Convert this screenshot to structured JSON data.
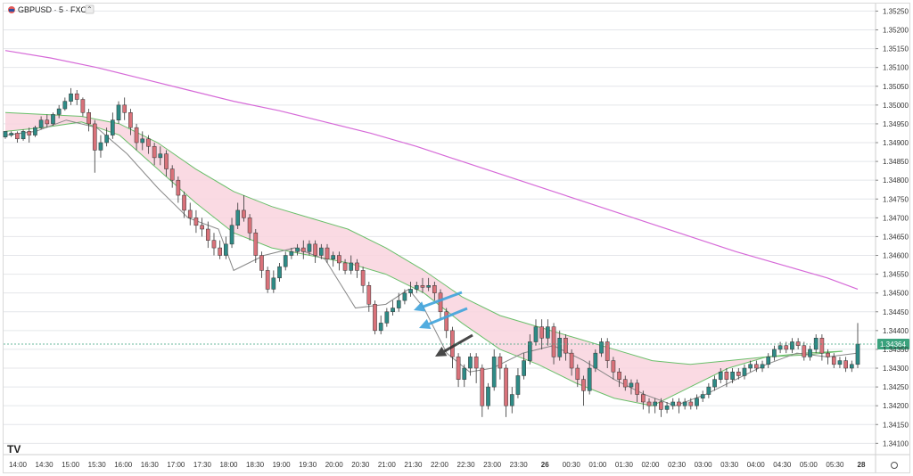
{
  "header": {
    "symbol_title": "GBPUSD · 5 · FXCM",
    "logo_mark": "TV"
  },
  "chart_data": {
    "type": "candlestick",
    "title": "GBPUSD · 5 · FXCM",
    "y_ticks": [
      "1.35250",
      "1.35200",
      "1.35150",
      "1.35100",
      "1.35050",
      "1.35000",
      "1.34950",
      "1.34900",
      "1.34850",
      "1.34800",
      "1.34750",
      "1.34700",
      "1.34650",
      "1.34600",
      "1.34550",
      "1.34500",
      "1.34450",
      "1.34400",
      "1.34350",
      "1.34300",
      "1.34250",
      "1.34200",
      "1.34150",
      "1.34100"
    ],
    "ylim": [
      1.3407,
      1.3527
    ],
    "x_ticks": [
      "14:00",
      "14:30",
      "15:00",
      "15:30",
      "16:00",
      "16:30",
      "17:00",
      "17:30",
      "18:00",
      "18:30",
      "19:00",
      "19:30",
      "20:00",
      "20:30",
      "21:00",
      "21:30",
      "22:00",
      "22:30",
      "23:00",
      "23:30",
      "26",
      "00:30",
      "01:00",
      "01:30",
      "02:00",
      "02:30",
      "03:00",
      "03:30",
      "04:00",
      "04:30",
      "05:00",
      "05:30",
      "28"
    ],
    "current_price": "1.34364",
    "colors": {
      "up": "#2e8b86",
      "down": "#d9727a",
      "long_ma": "#d66ad8",
      "band_fill": "#f9d4de",
      "band_edge": "#6abf6a",
      "fast_ma": "#888888",
      "arrow_blue": "#3ea3dc",
      "arrow_dark": "#333333",
      "price_tag": "#3aa27d"
    },
    "long_ma": [
      [
        0,
        1.35145
      ],
      [
        12,
        1.35125
      ],
      [
        24,
        1.351
      ],
      [
        36,
        1.3507
      ],
      [
        48,
        1.3504
      ],
      [
        60,
        1.3501
      ],
      [
        72,
        1.34985
      ],
      [
        84,
        1.34955
      ],
      [
        96,
        1.34925
      ],
      [
        108,
        1.3489
      ],
      [
        120,
        1.3485
      ],
      [
        132,
        1.3481
      ],
      [
        144,
        1.3477
      ],
      [
        156,
        1.3473
      ],
      [
        168,
        1.3469
      ],
      [
        180,
        1.3465
      ],
      [
        192,
        1.3461
      ],
      [
        204,
        1.34575
      ],
      [
        216,
        1.3454
      ],
      [
        224,
        1.3451
      ]
    ],
    "band_upper": [
      [
        0,
        1.3498
      ],
      [
        10,
        1.34975
      ],
      [
        20,
        1.3497
      ],
      [
        30,
        1.3495
      ],
      [
        40,
        1.349
      ],
      [
        50,
        1.3483
      ],
      [
        60,
        1.3477
      ],
      [
        70,
        1.3473
      ],
      [
        80,
        1.347
      ],
      [
        90,
        1.3467
      ],
      [
        100,
        1.3462
      ],
      [
        110,
        1.3456
      ],
      [
        120,
        1.3449
      ],
      [
        130,
        1.3444
      ],
      [
        140,
        1.3441
      ],
      [
        150,
        1.3438
      ],
      [
        160,
        1.3435
      ],
      [
        170,
        1.3432
      ],
      [
        180,
        1.3431
      ],
      [
        190,
        1.3432
      ],
      [
        200,
        1.3433
      ],
      [
        210,
        1.3434
      ],
      [
        220,
        1.34345
      ]
    ],
    "band_lower": [
      [
        0,
        1.3493
      ],
      [
        10,
        1.3494
      ],
      [
        20,
        1.34955
      ],
      [
        30,
        1.3492
      ],
      [
        40,
        1.3483
      ],
      [
        50,
        1.3474
      ],
      [
        60,
        1.3466
      ],
      [
        70,
        1.3462
      ],
      [
        80,
        1.346
      ],
      [
        90,
        1.3458
      ],
      [
        100,
        1.3455
      ],
      [
        110,
        1.345
      ],
      [
        120,
        1.3442
      ],
      [
        130,
        1.3435
      ],
      [
        140,
        1.3431
      ],
      [
        150,
        1.3426
      ],
      [
        160,
        1.3422
      ],
      [
        170,
        1.342
      ],
      [
        180,
        1.3425
      ],
      [
        190,
        1.343
      ],
      [
        200,
        1.3433
      ],
      [
        210,
        1.34335
      ],
      [
        220,
        1.34345
      ]
    ],
    "fast_ma": [
      [
        0,
        1.3492
      ],
      [
        8,
        1.3493
      ],
      [
        16,
        1.3496
      ],
      [
        24,
        1.3494
      ],
      [
        32,
        1.3487
      ],
      [
        40,
        1.3478
      ],
      [
        48,
        1.347
      ],
      [
        56,
        1.3467
      ],
      [
        60,
        1.3456
      ],
      [
        68,
        1.346
      ],
      [
        76,
        1.3462
      ],
      [
        84,
        1.3459
      ],
      [
        92,
        1.3446
      ],
      [
        100,
        1.3447
      ],
      [
        106,
        1.3451
      ],
      [
        110,
        1.3446
      ],
      [
        116,
        1.3434
      ],
      [
        122,
        1.3429
      ],
      [
        128,
        1.343
      ],
      [
        136,
        1.3434
      ],
      [
        144,
        1.3436
      ],
      [
        152,
        1.3432
      ],
      [
        160,
        1.3427
      ],
      [
        168,
        1.3423
      ],
      [
        176,
        1.342
      ],
      [
        184,
        1.3423
      ],
      [
        192,
        1.3427
      ],
      [
        200,
        1.3431
      ],
      [
        208,
        1.3434
      ],
      [
        216,
        1.3433
      ],
      [
        224,
        1.3434
      ]
    ],
    "candles": [
      [
        0,
        1.34915,
        1.3493,
        1.3493,
        1.3491
      ],
      [
        1,
        1.3492,
        1.34925,
        1.3493,
        1.34915
      ],
      [
        2,
        1.34925,
        1.3491,
        1.3493,
        1.349
      ],
      [
        3,
        1.3491,
        1.3493,
        1.34935,
        1.34905
      ],
      [
        4,
        1.3493,
        1.3492,
        1.3494,
        1.349
      ],
      [
        5,
        1.3492,
        1.3494,
        1.34945,
        1.34915
      ],
      [
        6,
        1.3494,
        1.3496,
        1.3497,
        1.34935
      ],
      [
        7,
        1.3496,
        1.3495,
        1.34975,
        1.3494
      ],
      [
        8,
        1.3495,
        1.34975,
        1.3498,
        1.34945
      ],
      [
        9,
        1.34975,
        1.3499,
        1.35,
        1.34965
      ],
      [
        10,
        1.3499,
        1.3501,
        1.3502,
        1.34985
      ],
      [
        11,
        1.3501,
        1.3503,
        1.35045,
        1.35
      ],
      [
        12,
        1.3503,
        1.35015,
        1.3504,
        1.35
      ],
      [
        13,
        1.35015,
        1.3498,
        1.3502,
        1.3497
      ],
      [
        14,
        1.3498,
        1.3495,
        1.3499,
        1.3493
      ],
      [
        15,
        1.3495,
        1.3488,
        1.3496,
        1.3482
      ],
      [
        16,
        1.3488,
        1.349,
        1.3492,
        1.3486
      ],
      [
        17,
        1.349,
        1.3492,
        1.3494,
        1.3489
      ],
      [
        18,
        1.3492,
        1.3496,
        1.3498,
        1.3491
      ],
      [
        19,
        1.3496,
        1.35,
        1.3501,
        1.3495
      ],
      [
        20,
        1.35,
        1.3498,
        1.3502,
        1.3496
      ],
      [
        21,
        1.3498,
        1.3494,
        1.3499,
        1.3492
      ],
      [
        22,
        1.3494,
        1.349,
        1.3495,
        1.3488
      ],
      [
        23,
        1.349,
        1.3491,
        1.3493,
        1.3488
      ],
      [
        24,
        1.3491,
        1.3489,
        1.3492,
        1.3487
      ],
      [
        25,
        1.3489,
        1.3486,
        1.349,
        1.3484
      ],
      [
        26,
        1.3486,
        1.3487,
        1.3489,
        1.3484
      ],
      [
        27,
        1.3487,
        1.3483,
        1.3488,
        1.3481
      ],
      [
        28,
        1.3483,
        1.348,
        1.3484,
        1.3478
      ],
      [
        29,
        1.348,
        1.3476,
        1.3481,
        1.3474
      ],
      [
        30,
        1.3476,
        1.3472,
        1.3477,
        1.347
      ],
      [
        31,
        1.3472,
        1.347,
        1.3474,
        1.3468
      ],
      [
        32,
        1.347,
        1.3468,
        1.3472,
        1.3466
      ],
      [
        33,
        1.3468,
        1.3467,
        1.347,
        1.3465
      ],
      [
        34,
        1.3467,
        1.3464,
        1.3469,
        1.3462
      ],
      [
        35,
        1.3464,
        1.3462,
        1.3466,
        1.346
      ],
      [
        36,
        1.3462,
        1.346,
        1.3464,
        1.3459
      ],
      [
        37,
        1.346,
        1.3463,
        1.3465,
        1.3459
      ],
      [
        38,
        1.3463,
        1.3468,
        1.347,
        1.3462
      ],
      [
        39,
        1.3468,
        1.3472,
        1.3474,
        1.3467
      ],
      [
        40,
        1.3472,
        1.347,
        1.3476,
        1.3469
      ],
      [
        41,
        1.347,
        1.3466,
        1.3471,
        1.3464
      ],
      [
        42,
        1.3466,
        1.346,
        1.3467,
        1.3458
      ],
      [
        43,
        1.346,
        1.3456,
        1.3461,
        1.3454
      ],
      [
        44,
        1.3456,
        1.3451,
        1.3457,
        1.345
      ],
      [
        45,
        1.3451,
        1.3454,
        1.3456,
        1.345
      ],
      [
        46,
        1.3454,
        1.3457,
        1.3458,
        1.3453
      ],
      [
        47,
        1.3457,
        1.346,
        1.3461,
        1.3456
      ],
      [
        48,
        1.346,
        1.3461,
        1.3462,
        1.3459
      ],
      [
        49,
        1.3461,
        1.3462,
        1.3463,
        1.346
      ],
      [
        50,
        1.3462,
        1.3461,
        1.3464,
        1.3459
      ],
      [
        51,
        1.3461,
        1.3463,
        1.3464,
        1.346
      ],
      [
        52,
        1.3463,
        1.346,
        1.3464,
        1.3458
      ],
      [
        53,
        1.346,
        1.3462,
        1.3463,
        1.3459
      ],
      [
        54,
        1.3462,
        1.3459,
        1.3463,
        1.3458
      ],
      [
        55,
        1.3459,
        1.346,
        1.3461,
        1.3457
      ],
      [
        56,
        1.346,
        1.3458,
        1.3461,
        1.3456
      ],
      [
        57,
        1.3458,
        1.3456,
        1.3459,
        1.3455
      ],
      [
        58,
        1.3456,
        1.3458,
        1.346,
        1.3455
      ],
      [
        59,
        1.3458,
        1.3456,
        1.3459,
        1.3454
      ],
      [
        60,
        1.3456,
        1.3452,
        1.3457,
        1.345
      ],
      [
        61,
        1.3452,
        1.3447,
        1.3453,
        1.3445
      ],
      [
        62,
        1.3447,
        1.344,
        1.3448,
        1.3439
      ],
      [
        63,
        1.344,
        1.3442,
        1.3444,
        1.3439
      ],
      [
        64,
        1.3442,
        1.3445,
        1.3446,
        1.3441
      ],
      [
        65,
        1.3445,
        1.3446,
        1.3448,
        1.3444
      ],
      [
        66,
        1.3446,
        1.3448,
        1.345,
        1.3445
      ],
      [
        67,
        1.3448,
        1.345,
        1.3451,
        1.3447
      ],
      [
        68,
        1.345,
        1.3451,
        1.3453,
        1.3449
      ],
      [
        69,
        1.3451,
        1.3452,
        1.3453,
        1.345
      ],
      [
        70,
        1.3452,
        1.34515,
        1.3454,
        1.345
      ],
      [
        71,
        1.34515,
        1.3452,
        1.3454,
        1.34505
      ],
      [
        72,
        1.3452,
        1.345,
        1.3453,
        1.3448
      ],
      [
        73,
        1.345,
        1.3445,
        1.3451,
        1.3443
      ],
      [
        74,
        1.3445,
        1.344,
        1.3446,
        1.3438
      ],
      [
        75,
        1.344,
        1.3433,
        1.3441,
        1.343
      ],
      [
        76,
        1.3433,
        1.3427,
        1.3434,
        1.3425
      ],
      [
        77,
        1.3427,
        1.343,
        1.3431,
        1.3425
      ],
      [
        78,
        1.343,
        1.3433,
        1.3434,
        1.3428
      ],
      [
        79,
        1.3433,
        1.343,
        1.3434,
        1.3426
      ],
      [
        80,
        1.343,
        1.342,
        1.3431,
        1.3417
      ],
      [
        81,
        1.342,
        1.3425,
        1.3426,
        1.3419
      ],
      [
        82,
        1.3425,
        1.3433,
        1.3435,
        1.3424
      ],
      [
        83,
        1.3433,
        1.343,
        1.3434,
        1.3427
      ],
      [
        84,
        1.343,
        1.342,
        1.3431,
        1.3417
      ],
      [
        85,
        1.342,
        1.3423,
        1.3425,
        1.3418
      ],
      [
        86,
        1.3423,
        1.3428,
        1.343,
        1.3422
      ],
      [
        87,
        1.3428,
        1.3432,
        1.3434,
        1.3427
      ],
      [
        88,
        1.3432,
        1.3437,
        1.3439,
        1.3431
      ],
      [
        89,
        1.3437,
        1.3441,
        1.3443,
        1.3436
      ],
      [
        90,
        1.3441,
        1.3438,
        1.3443,
        1.3435
      ],
      [
        91,
        1.3438,
        1.3441,
        1.3443,
        1.3436
      ],
      [
        92,
        1.3441,
        1.3433,
        1.3442,
        1.3431
      ],
      [
        93,
        1.3433,
        1.3438,
        1.344,
        1.3432
      ],
      [
        94,
        1.3438,
        1.3434,
        1.3439,
        1.3432
      ],
      [
        95,
        1.3434,
        1.343,
        1.3435,
        1.3428
      ],
      [
        96,
        1.343,
        1.3427,
        1.3431,
        1.3425
      ],
      [
        97,
        1.3427,
        1.3424,
        1.3428,
        1.342
      ],
      [
        98,
        1.3424,
        1.343,
        1.3432,
        1.3423
      ],
      [
        99,
        1.343,
        1.3434,
        1.3435,
        1.3429
      ],
      [
        100,
        1.3434,
        1.3437,
        1.3438,
        1.3433
      ],
      [
        101,
        1.3437,
        1.3432,
        1.3438,
        1.343
      ],
      [
        102,
        1.3432,
        1.3429,
        1.3433,
        1.3427
      ],
      [
        103,
        1.3429,
        1.3427,
        1.343,
        1.3425
      ],
      [
        104,
        1.3427,
        1.3425,
        1.3428,
        1.3424
      ],
      [
        105,
        1.3425,
        1.3426,
        1.3427,
        1.3423
      ],
      [
        106,
        1.3426,
        1.3423,
        1.3427,
        1.3421
      ],
      [
        107,
        1.3423,
        1.3421,
        1.3424,
        1.3419
      ],
      [
        108,
        1.3421,
        1.342,
        1.3422,
        1.3418
      ],
      [
        109,
        1.342,
        1.3421,
        1.3422,
        1.3418
      ],
      [
        110,
        1.3421,
        1.3419,
        1.3422,
        1.3417
      ],
      [
        111,
        1.3419,
        1.342,
        1.3421,
        1.3418
      ],
      [
        112,
        1.342,
        1.3421,
        1.3422,
        1.3419
      ],
      [
        113,
        1.3421,
        1.342,
        1.3422,
        1.3418
      ],
      [
        114,
        1.342,
        1.3421,
        1.3422,
        1.3419
      ],
      [
        115,
        1.3421,
        1.342,
        1.3422,
        1.3419
      ],
      [
        116,
        1.342,
        1.3422,
        1.3423,
        1.3419
      ],
      [
        117,
        1.3422,
        1.3423,
        1.3424,
        1.3421
      ],
      [
        118,
        1.3423,
        1.3425,
        1.3426,
        1.3422
      ],
      [
        119,
        1.3425,
        1.3427,
        1.3428,
        1.3424
      ],
      [
        120,
        1.3427,
        1.3429,
        1.343,
        1.3426
      ],
      [
        121,
        1.3429,
        1.3427,
        1.343,
        1.3425
      ],
      [
        122,
        1.3427,
        1.3429,
        1.343,
        1.3426
      ],
      [
        123,
        1.3429,
        1.3428,
        1.343,
        1.3427
      ],
      [
        124,
        1.3428,
        1.343,
        1.3431,
        1.3427
      ],
      [
        125,
        1.343,
        1.3431,
        1.3432,
        1.3429
      ],
      [
        126,
        1.3431,
        1.343,
        1.3432,
        1.3429
      ],
      [
        127,
        1.343,
        1.3431,
        1.3432,
        1.3429
      ],
      [
        128,
        1.3431,
        1.3433,
        1.3434,
        1.343
      ],
      [
        129,
        1.3433,
        1.3435,
        1.3436,
        1.3432
      ],
      [
        130,
        1.3435,
        1.3436,
        1.3437,
        1.3434
      ],
      [
        131,
        1.3436,
        1.3435,
        1.3437,
        1.3434
      ],
      [
        132,
        1.3435,
        1.3437,
        1.3438,
        1.3434
      ],
      [
        133,
        1.3437,
        1.3436,
        1.3438,
        1.3435
      ],
      [
        134,
        1.3436,
        1.3433,
        1.3437,
        1.3432
      ],
      [
        135,
        1.3433,
        1.3435,
        1.3436,
        1.3432
      ],
      [
        136,
        1.3435,
        1.3438,
        1.3439,
        1.3434
      ],
      [
        137,
        1.3438,
        1.3434,
        1.3439,
        1.3432
      ],
      [
        138,
        1.3434,
        1.3433,
        1.3435,
        1.3431
      ],
      [
        139,
        1.3433,
        1.3431,
        1.3434,
        1.343
      ],
      [
        140,
        1.3431,
        1.3432,
        1.3433,
        1.343
      ],
      [
        141,
        1.3432,
        1.343,
        1.3433,
        1.3429
      ],
      [
        142,
        1.343,
        1.3431,
        1.3432,
        1.3429
      ],
      [
        143,
        1.3431,
        1.34364,
        1.3442,
        1.343
      ]
    ]
  }
}
